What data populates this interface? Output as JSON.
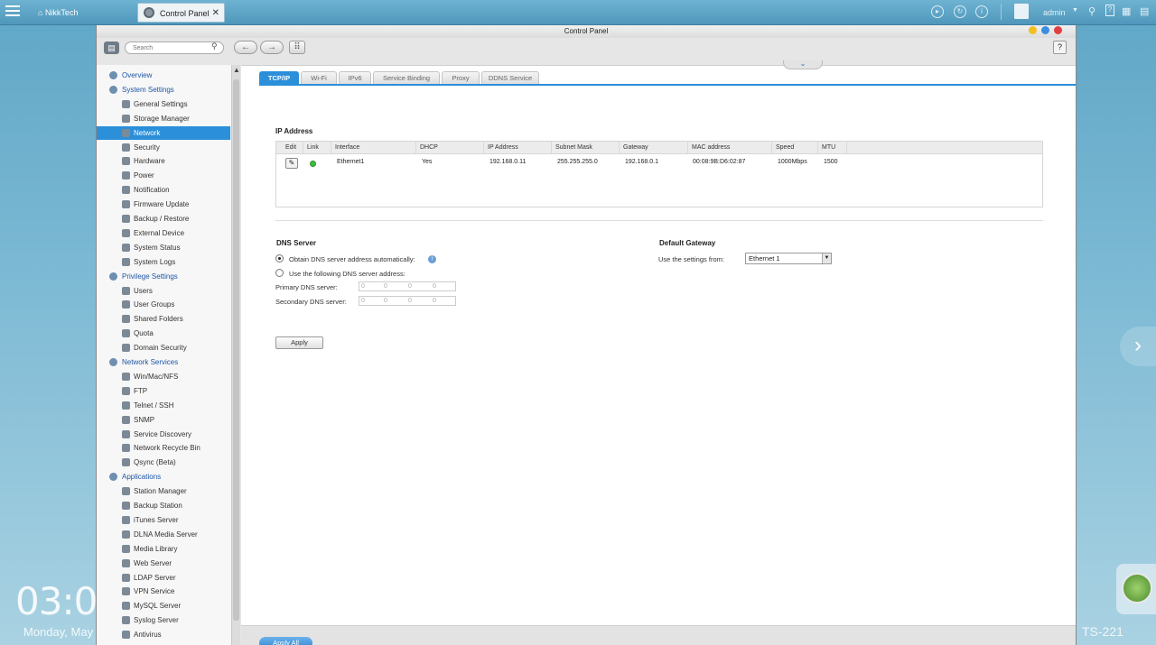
{
  "taskbar": {
    "home_label": "NikkTech",
    "app_tab_label": "Control Panel",
    "user_label": "admin"
  },
  "window": {
    "title": "Control Panel",
    "search_placeholder": "Search",
    "help_label": "?"
  },
  "sidebar": {
    "items": [
      {
        "label": "Overview",
        "level": "cat"
      },
      {
        "label": "System Settings",
        "level": "cat"
      },
      {
        "label": "General Settings",
        "level": "sub"
      },
      {
        "label": "Storage Manager",
        "level": "sub"
      },
      {
        "label": "Network",
        "level": "sub",
        "active": true
      },
      {
        "label": "Security",
        "level": "sub"
      },
      {
        "label": "Hardware",
        "level": "sub"
      },
      {
        "label": "Power",
        "level": "sub"
      },
      {
        "label": "Notification",
        "level": "sub"
      },
      {
        "label": "Firmware Update",
        "level": "sub"
      },
      {
        "label": "Backup / Restore",
        "level": "sub"
      },
      {
        "label": "External Device",
        "level": "sub"
      },
      {
        "label": "System Status",
        "level": "sub"
      },
      {
        "label": "System Logs",
        "level": "sub"
      },
      {
        "label": "Privilege Settings",
        "level": "cat"
      },
      {
        "label": "Users",
        "level": "sub"
      },
      {
        "label": "User Groups",
        "level": "sub"
      },
      {
        "label": "Shared Folders",
        "level": "sub"
      },
      {
        "label": "Quota",
        "level": "sub"
      },
      {
        "label": "Domain Security",
        "level": "sub"
      },
      {
        "label": "Network Services",
        "level": "cat"
      },
      {
        "label": "Win/Mac/NFS",
        "level": "sub"
      },
      {
        "label": "FTP",
        "level": "sub"
      },
      {
        "label": "Telnet / SSH",
        "level": "sub"
      },
      {
        "label": "SNMP",
        "level": "sub"
      },
      {
        "label": "Service Discovery",
        "level": "sub"
      },
      {
        "label": "Network Recycle Bin",
        "level": "sub"
      },
      {
        "label": "Qsync (Beta)",
        "level": "sub"
      },
      {
        "label": "Applications",
        "level": "cat"
      },
      {
        "label": "Station Manager",
        "level": "sub"
      },
      {
        "label": "Backup Station",
        "level": "sub"
      },
      {
        "label": "iTunes Server",
        "level": "sub"
      },
      {
        "label": "DLNA Media Server",
        "level": "sub"
      },
      {
        "label": "Media Library",
        "level": "sub"
      },
      {
        "label": "Web Server",
        "level": "sub"
      },
      {
        "label": "LDAP Server",
        "level": "sub"
      },
      {
        "label": "VPN Service",
        "level": "sub"
      },
      {
        "label": "MySQL Server",
        "level": "sub"
      },
      {
        "label": "Syslog Server",
        "level": "sub"
      },
      {
        "label": "Antivirus",
        "level": "sub"
      }
    ]
  },
  "tabs": [
    "TCP/IP",
    "Wi-Fi",
    "IPv6",
    "Service Binding",
    "Proxy",
    "DDNS Service"
  ],
  "ip_section": {
    "title": "IP Address",
    "columns": [
      "Edit",
      "Link",
      "Interface",
      "DHCP",
      "IP Address",
      "Subnet Mask",
      "Gateway",
      "MAC address",
      "Speed",
      "MTU"
    ],
    "row": {
      "interface": "Ethernet1",
      "dhcp": "Yes",
      "ip": "192.168.0.11",
      "mask": "255.255.255.0",
      "gateway": "192.168.0.1",
      "mac": "00:08:9B:D6:02:87",
      "speed": "1000Mbps",
      "mtu": "1500"
    }
  },
  "dns": {
    "title": "DNS Server",
    "auto_label": "Obtain DNS server address automatically:",
    "manual_label": "Use the following DNS server address:",
    "primary_label": "Primary DNS server:",
    "secondary_label": "Secondary DNS server:",
    "octet_value": "0"
  },
  "gateway": {
    "title": "Default Gateway",
    "use_label": "Use the settings from:",
    "selected": "Ethernet 1"
  },
  "buttons": {
    "apply": "Apply",
    "apply_all": "Apply All"
  },
  "desktop": {
    "clock": "03:0",
    "date": "Monday, May",
    "model": "TS-221"
  },
  "colors": {
    "accent": "#2b8fd9",
    "category_text": "#1d56a8",
    "link_ok": "#3fbf3f"
  }
}
